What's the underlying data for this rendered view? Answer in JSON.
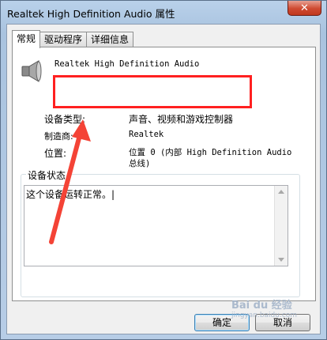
{
  "window": {
    "title": "Realtek High Definition Audio 属性",
    "close_glyph": "✕"
  },
  "tabs": [
    {
      "label": "常规",
      "active": true
    },
    {
      "label": "驱动程序",
      "active": false
    },
    {
      "label": "详细信息",
      "active": false
    }
  ],
  "device": {
    "icon": "speaker-icon",
    "name": "Realtek High Definition Audio"
  },
  "properties": {
    "type_label": "设备类型:",
    "type_value": "声音、视频和游戏控制器",
    "manufacturer_label": "制造商:",
    "manufacturer_value": "Realtek",
    "location_label": "位置:",
    "location_value_line1": "位置 0 (内部 High Definition Audio",
    "location_value_line2": "总线)"
  },
  "status_group": {
    "title": "设备状态",
    "text": "这个设备运转正常。|"
  },
  "buttons": {
    "ok": "确定",
    "cancel": "取消"
  },
  "watermark": {
    "brand": "Bai du 经验",
    "url": "jingyan.baidu.com"
  },
  "colors": {
    "highlight": "#ff2020",
    "arrow": "#f44336"
  }
}
